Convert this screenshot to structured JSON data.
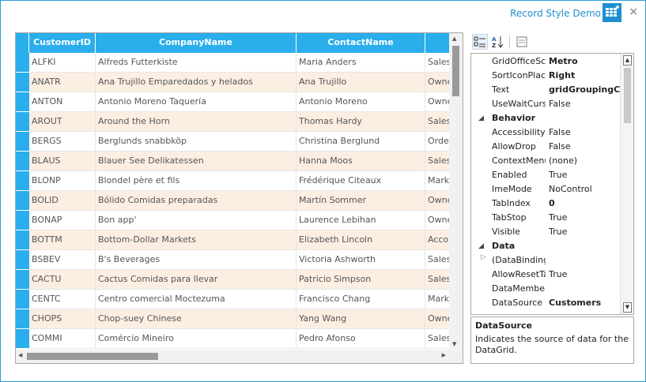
{
  "window": {
    "title": "Record Style Demo",
    "close_glyph": "×"
  },
  "grid": {
    "columns": [
      "CustomerID",
      "CompanyName",
      "ContactName",
      ""
    ],
    "rows": [
      [
        "ALFKI",
        "Alfreds Futterkiste",
        "Maria Anders",
        "Sales"
      ],
      [
        "ANATR",
        "Ana Trujillo Emparedados y helados",
        "Ana Trujillo",
        "Owne"
      ],
      [
        "ANTON",
        "Antonio Moreno Taquería",
        "Antonio Moreno",
        "Owne"
      ],
      [
        "AROUT",
        "Around the Horn",
        "Thomas Hardy",
        "Sales"
      ],
      [
        "BERGS",
        "Berglunds snabbköp",
        "Christina Berglund",
        "Orde"
      ],
      [
        "BLAUS",
        "Blauer See Delikatessen",
        "Hanna Moos",
        "Sales"
      ],
      [
        "BLONP",
        "Blondel père et fils",
        "Frédérique Citeaux",
        "Mark"
      ],
      [
        "BOLID",
        "Bólido Comidas preparadas",
        "Martín Sommer",
        "Owne"
      ],
      [
        "BONAP",
        "Bon app'",
        "Laurence Lebihan",
        "Owne"
      ],
      [
        "BOTTM",
        "Bottom-Dollar Markets",
        "Elizabeth Lincoln",
        "Acco"
      ],
      [
        "BSBEV",
        "B's Beverages",
        "Victoria Ashworth",
        "Sales"
      ],
      [
        "CACTU",
        "Cactus Comidas para llevar",
        "Patricio Simpson",
        "Sales"
      ],
      [
        "CENTC",
        "Centro comercial Moctezuma",
        "Francisco Chang",
        "Mark"
      ],
      [
        "CHOPS",
        "Chop-suey Chinese",
        "Yang Wang",
        "Owne"
      ],
      [
        "COMMI",
        "Comércio Mineiro",
        "Pedro Afonso",
        "Sales"
      ]
    ]
  },
  "property_grid": {
    "items": [
      {
        "kind": "prop",
        "name": "GridOfficeScr",
        "value": "Metro",
        "bold": true
      },
      {
        "kind": "prop",
        "name": "SortIconPlace",
        "value": "Right",
        "bold": true
      },
      {
        "kind": "prop",
        "name": "Text",
        "value": "gridGroupingCon",
        "bold": true
      },
      {
        "kind": "prop",
        "name": "UseWaitCursc",
        "value": "False",
        "bold": false
      },
      {
        "kind": "cat",
        "name": "Behavior",
        "toggle": "◢"
      },
      {
        "kind": "prop",
        "name": "AccessibilityE",
        "value": "False",
        "bold": false
      },
      {
        "kind": "prop",
        "name": "AllowDrop",
        "value": "False",
        "bold": false
      },
      {
        "kind": "prop",
        "name": "ContextMenu",
        "value": "(none)",
        "bold": false
      },
      {
        "kind": "prop",
        "name": "Enabled",
        "value": "True",
        "bold": false
      },
      {
        "kind": "prop",
        "name": "ImeMode",
        "value": "NoControl",
        "bold": false
      },
      {
        "kind": "prop",
        "name": "TabIndex",
        "value": "0",
        "bold": true
      },
      {
        "kind": "prop",
        "name": "TabStop",
        "value": "True",
        "bold": false
      },
      {
        "kind": "prop",
        "name": "Visible",
        "value": "True",
        "bold": false
      },
      {
        "kind": "cat",
        "name": "Data",
        "toggle": "◢"
      },
      {
        "kind": "prop",
        "name": "(DataBindings",
        "value": "",
        "bold": false,
        "expander": "▷"
      },
      {
        "kind": "prop",
        "name": "AllowResetTa",
        "value": "True",
        "bold": false
      },
      {
        "kind": "prop",
        "name": "DataMember",
        "value": "",
        "bold": false
      },
      {
        "kind": "prop",
        "name": "DataSource",
        "value": "Customers",
        "bold": true
      }
    ],
    "help_title": "DataSource",
    "help_text": "Indicates the source of data for the DataGrid."
  },
  "colors": {
    "accent": "#2aaeec",
    "alt_row": "#fcefe2",
    "title": "#1e8fd0"
  }
}
